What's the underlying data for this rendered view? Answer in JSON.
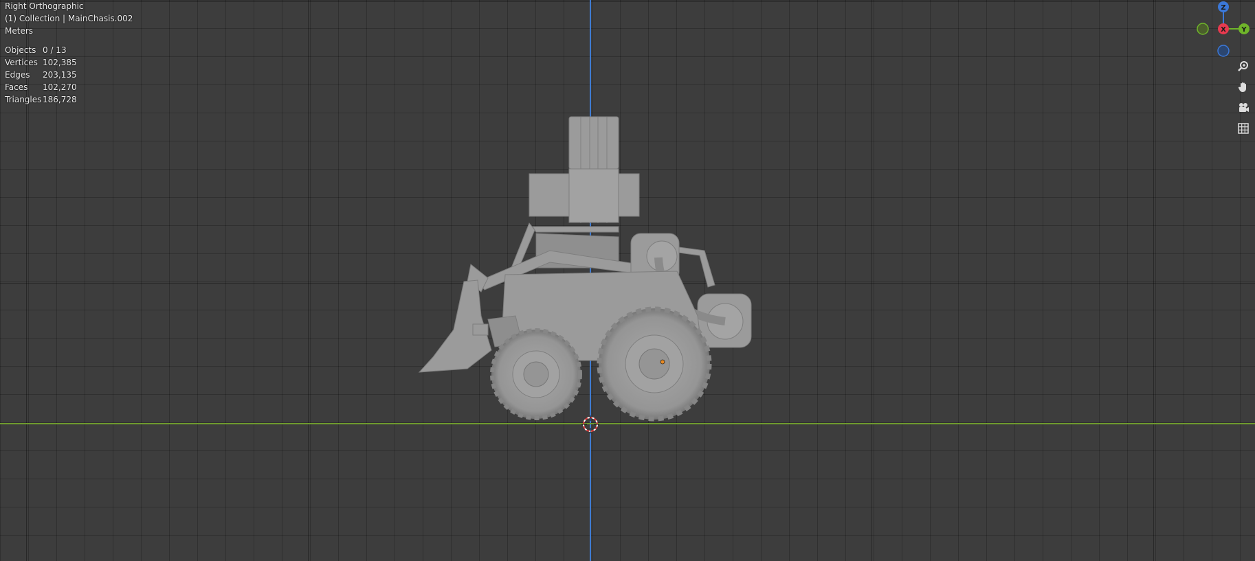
{
  "viewport": {
    "view_name": "Right Orthographic",
    "collection_line": "(1) Collection | MainChasis.002",
    "units": "Meters"
  },
  "stats": [
    {
      "label": "Objects",
      "value": "0 / 13"
    },
    {
      "label": "Vertices",
      "value": "102,385"
    },
    {
      "label": "Edges",
      "value": "203,135"
    },
    {
      "label": "Faces",
      "value": "102,270"
    },
    {
      "label": "Triangles",
      "value": "186,728"
    }
  ],
  "gizmo": {
    "z_label": "Z",
    "x_label": "X",
    "y_label": "Y",
    "colors": {
      "z": "#3b78d8",
      "x": "#e83a4f",
      "y": "#6fb52a"
    }
  },
  "nav_tools": [
    {
      "name": "zoom-icon"
    },
    {
      "name": "hand-pan-icon"
    },
    {
      "name": "camera-view-icon"
    },
    {
      "name": "grid-toggle-icon"
    }
  ],
  "scene": {
    "object": "wheel loader mesh",
    "origin_color": "#e88a22"
  }
}
